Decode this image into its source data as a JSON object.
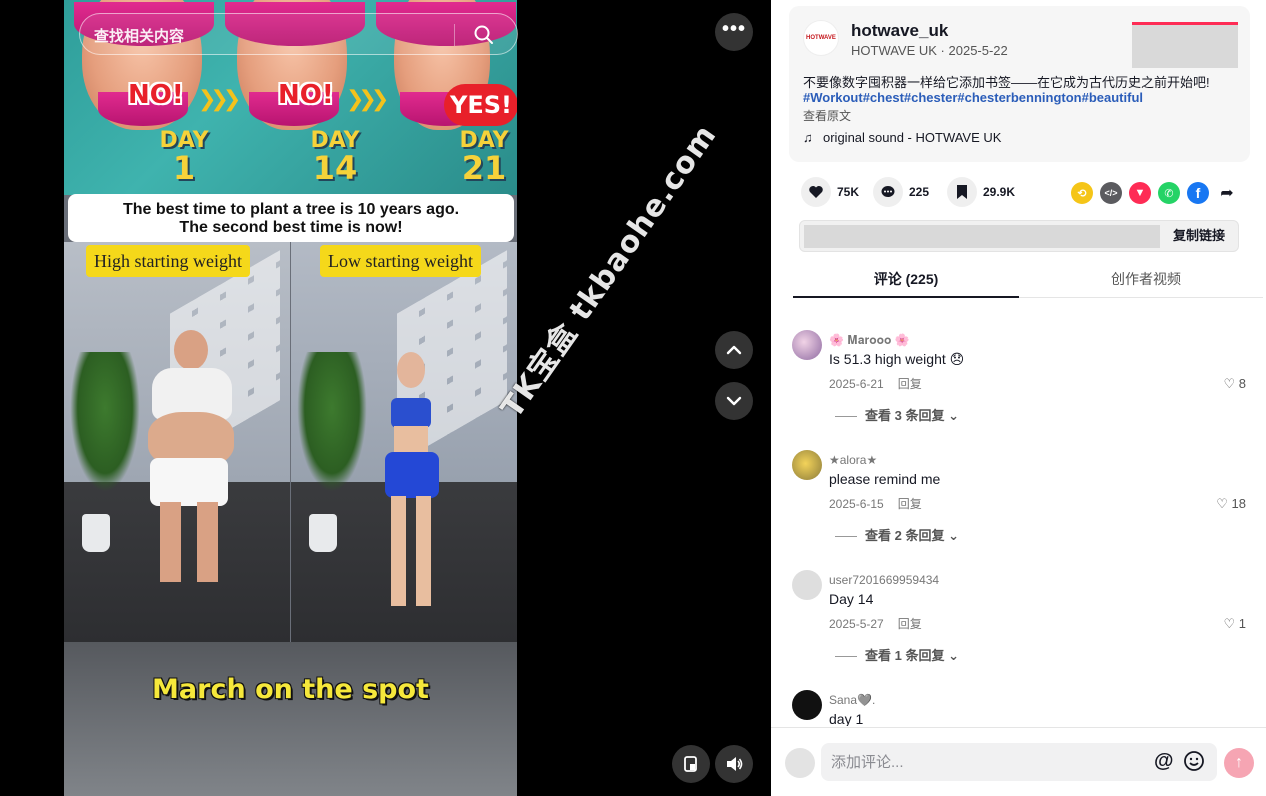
{
  "video": {
    "search_placeholder": "查找相关内容",
    "banner": {
      "verdicts": [
        "NO!",
        "NO!",
        "YES!"
      ],
      "days": [
        {
          "label": "DAY",
          "number": "1"
        },
        {
          "label": "DAY",
          "number": "14"
        },
        {
          "label": "DAY",
          "number": "21"
        }
      ]
    },
    "quote_line1": "The best time to plant a tree is 10 years ago.",
    "quote_line2": "The second best time is now!",
    "tag_left": "High starting weight",
    "tag_right": "Low starting weight",
    "caption": "March on the spot",
    "watermark": "TK宝盒 tkbaohe.com"
  },
  "colors": {
    "accent_red": "#fe2c55",
    "hashtag_blue": "#2b5db9",
    "caption_yellow": "#f6e83b",
    "tag_yellow": "#f5d81a"
  },
  "post": {
    "author_logo_text": "HOTWAVE",
    "author_name": "hotwave_uk",
    "author_sub": "HOTWAVE UK · 2025-5-22",
    "description": "不要像数字囤积器一样给它添加书签——在它成为古代历史之前开始吧!",
    "hashtags": "#Workout#chest#chester#chesterbennington#beautiful",
    "see_original": "查看原文",
    "music": "original sound - HOTWAVE UK"
  },
  "stats": {
    "likes": "75K",
    "comments": "225",
    "saves": "29.9K"
  },
  "share_icons": [
    "repost-icon",
    "embed-icon",
    "send-icon",
    "whatsapp-icon",
    "facebook-icon",
    "share-arrow-icon"
  ],
  "copy_link_label": "复制链接",
  "tabs": {
    "comments": "评论 (225)",
    "creator_videos": "创作者视频"
  },
  "comments": [
    {
      "name": "🌸 𝐌𝐚𝐫𝐨𝐨𝐨 🌸",
      "text": "Is 51.3 high weight 😞",
      "date": "2025-6-21",
      "reply": "回复",
      "likes": "8",
      "replies": "查看 3 条回复",
      "avatar_color": "#b58fb8"
    },
    {
      "name": "★alora★",
      "text": "please remind me",
      "date": "2025-6-15",
      "reply": "回复",
      "likes": "18",
      "replies": "查看 2 条回复",
      "avatar_color": "#d6b73a"
    },
    {
      "name": "user7201669959434",
      "text": "Day 14",
      "date": "2025-5-27",
      "reply": "回复",
      "likes": "1",
      "replies": "查看 1 条回复",
      "avatar_color": "#dedede"
    },
    {
      "name": "Sana🩶.",
      "text": "day 1",
      "avatar_color": "#111111"
    }
  ],
  "comment_bar": {
    "placeholder": "添加评论...",
    "at_symbol": "@"
  }
}
